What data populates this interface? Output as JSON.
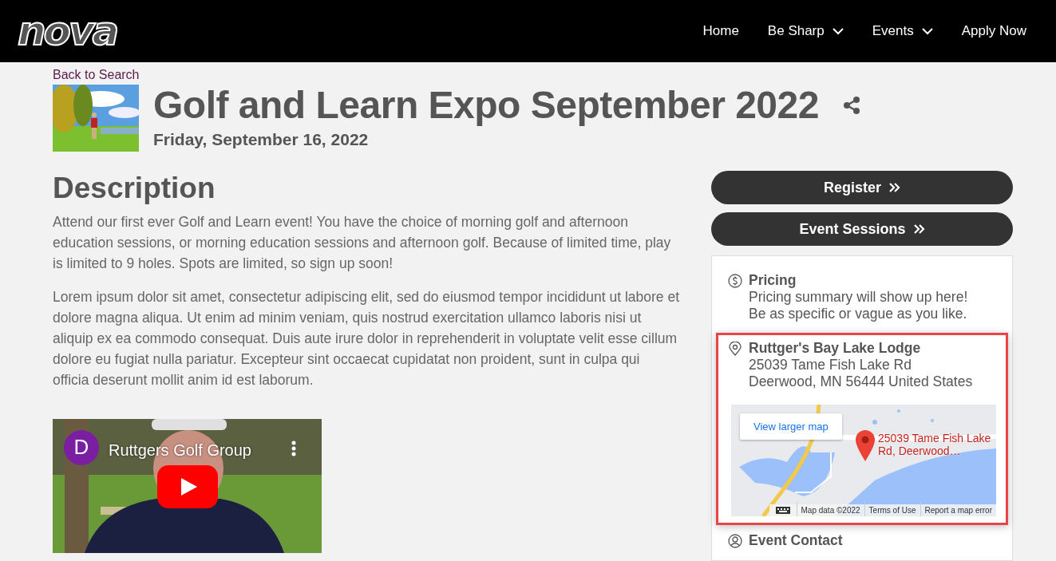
{
  "navbar": {
    "logo": "nova",
    "links": [
      {
        "label": "Home",
        "dropdown": false
      },
      {
        "label": "Be Sharp",
        "dropdown": true
      },
      {
        "label": "Events",
        "dropdown": true
      },
      {
        "label": "Apply Now",
        "dropdown": false
      }
    ]
  },
  "back_link": "Back to Search",
  "event": {
    "title": "Golf and Learn Expo September 2022",
    "date": "Friday, September 16, 2022"
  },
  "description": {
    "heading": "Description",
    "paragraphs": [
      "Attend our first ever Golf and Learn event! You have the choice of morning golf and afternoon education sessions, or morning education sessions and afternoon golf. Because of limited time, play is limited to 9 holes. Spots are limited, so sign up soon!",
      "Lorem ipsum dolor sit amet, consectetur adipiscing elit, sed do eiusmod tempor incididunt ut labore et dolore magna aliqua. Ut enim ad minim veniam, quis nostrud exercitation ullamco laboris nisi ut aliquip ex ea commodo consequat. Duis aute irure dolor in reprehenderit in voluptate velit esse cillum dolore eu fugiat nulla pariatur. Excepteur sint occaecat cupidatat non proident, sunt in culpa qui officia deserunt mollit anim id est laborum."
    ]
  },
  "video": {
    "avatar": "D",
    "channel": "Ruttgers Golf Group"
  },
  "actions": [
    "Register",
    "Event Sessions"
  ],
  "details": [
    {
      "kind": "pricing",
      "title": "Pricing",
      "lines": [
        "Pricing summary will show up here!",
        "Be as specific or vague as you like."
      ],
      "highlighted": false
    },
    {
      "kind": "location",
      "title": "Ruttger's Bay Lake Lodge",
      "lines": [
        "25039 Tame Fish Lake Rd",
        "Deerwood, MN 56444 United States"
      ],
      "highlighted": true,
      "map": {
        "button": "View larger map",
        "marker_label": "25039 Tame Fish Lake Rd, Deerwood…",
        "footer": [
          "Map data ©2022",
          "Terms of Use",
          "Report a map error"
        ]
      }
    },
    {
      "kind": "contact",
      "title": "Event Contact",
      "highlighted": false
    }
  ]
}
